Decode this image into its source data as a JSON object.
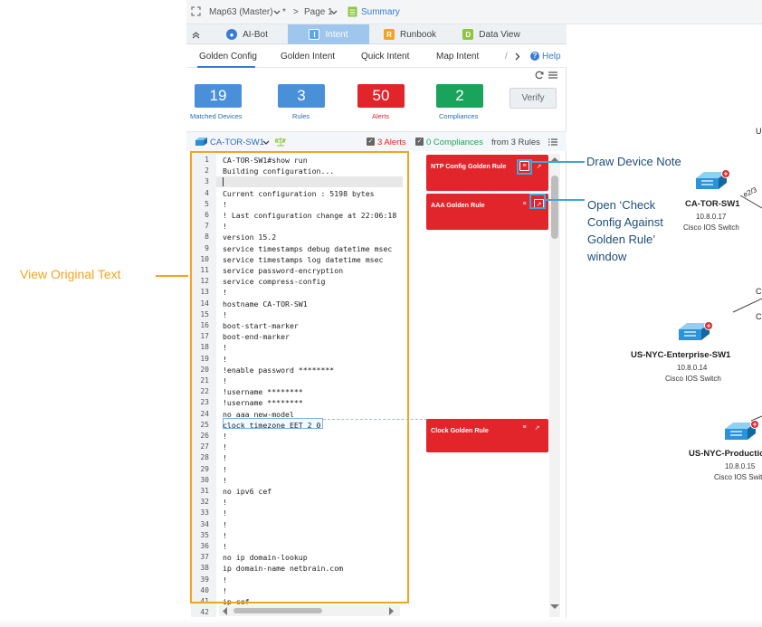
{
  "topbar": {
    "map_name": "Map63 (Master)",
    "modified_mark": "*",
    "separator": ">",
    "page": "Page 1",
    "summary": "Summary"
  },
  "tabs": [
    {
      "label": "AI-Bot",
      "icon": "ai"
    },
    {
      "label": "Intent",
      "icon": "I"
    },
    {
      "label": "Runbook",
      "icon": "R"
    },
    {
      "label": "Data View",
      "icon": "D"
    }
  ],
  "subtabs": [
    "Golden Config",
    "Golden Intent",
    "Quick Intent",
    "Map Intent"
  ],
  "subtabs_more": "/",
  "help_label": "Help",
  "stats": [
    {
      "value": "19",
      "label": "Matched Devices",
      "color": "#4a90d9"
    },
    {
      "value": "3",
      "label": "Rules",
      "color": "#4a90d9"
    },
    {
      "value": "50",
      "label": "Alerts",
      "color": "#e2242b"
    },
    {
      "value": "2",
      "label": "Compliances",
      "color": "#1aa35b"
    }
  ],
  "verify_label": "Verify",
  "device_bar": {
    "device": "CA-TOR-SW1",
    "alerts": "3 Alerts",
    "compliances": "0 Compliances",
    "from_rules": "from 3 Rules"
  },
  "code_lines": [
    {
      "n": "1",
      "text": "CA-TOR-SW1#show run"
    },
    {
      "n": "2",
      "text": "Building configuration..."
    },
    {
      "n": "3",
      "text": ""
    },
    {
      "n": "4",
      "text": "Current configuration : 5198 bytes"
    },
    {
      "n": "5",
      "text": "!"
    },
    {
      "n": "6",
      "text": "! Last configuration change at 22:06:18"
    },
    {
      "n": "7",
      "text": "!"
    },
    {
      "n": "8",
      "text": "version 15.2"
    },
    {
      "n": "9",
      "text": "service timestamps debug datetime msec"
    },
    {
      "n": "10",
      "text": "service timestamps log datetime msec"
    },
    {
      "n": "11",
      "text": "service password-encryption"
    },
    {
      "n": "12",
      "text": "service compress-config"
    },
    {
      "n": "13",
      "text": "!"
    },
    {
      "n": "14",
      "text": "hostname CA-TOR-SW1"
    },
    {
      "n": "15",
      "text": "!"
    },
    {
      "n": "16",
      "text": "boot-start-marker"
    },
    {
      "n": "17",
      "text": "boot-end-marker"
    },
    {
      "n": "18",
      "text": "!"
    },
    {
      "n": "19",
      "text": "!"
    },
    {
      "n": "20",
      "text": "!enable password ********"
    },
    {
      "n": "21",
      "text": "!"
    },
    {
      "n": "22",
      "text": "!username ********"
    },
    {
      "n": "23",
      "text": "!username ********"
    },
    {
      "n": "24",
      "text": "no aaa new-model"
    },
    {
      "n": "25",
      "text": "clock timezone EET 2 0"
    },
    {
      "n": "26",
      "text": "!"
    },
    {
      "n": "27",
      "text": "!"
    },
    {
      "n": "28",
      "text": "!"
    },
    {
      "n": "29",
      "text": "!"
    },
    {
      "n": "30",
      "text": "!"
    },
    {
      "n": "31",
      "text": "no ipv6 cef"
    },
    {
      "n": "32",
      "text": "!"
    },
    {
      "n": "33",
      "text": "!"
    },
    {
      "n": "34",
      "text": "!"
    },
    {
      "n": "35",
      "text": "!"
    },
    {
      "n": "36",
      "text": "!"
    },
    {
      "n": "37",
      "text": "no ip domain-lookup"
    },
    {
      "n": "38",
      "text": "ip domain-name netbrain.com"
    },
    {
      "n": "39",
      "text": "!"
    },
    {
      "n": "40",
      "text": "!"
    },
    {
      "n": "41",
      "text": "ip cef"
    },
    {
      "n": "42",
      "text": ""
    }
  ],
  "rules": [
    {
      "title": "NTP Config Golden Rule"
    },
    {
      "title": "AAA Golden Rule"
    },
    {
      "title": "Clock Golden Rule"
    }
  ],
  "annotations": {
    "view_original": "View Original Text",
    "draw_note": "Draw Device Note",
    "open_check": [
      "Open ‘Check",
      "Config Against",
      "Golden Rule’",
      "window"
    ]
  },
  "map": {
    "devices": [
      {
        "name": "CA-TOR-SW1",
        "ip": "10.8.0.17",
        "type": "Cisco IOS Switch"
      },
      {
        "name": "US-NYC-Enterprise-SW1",
        "ip": "10.8.0.14",
        "type": "Cisco IOS Switch"
      },
      {
        "name": "US-NYC-Productio",
        "ip": "10.8.0.15",
        "type": "Cisco IOS Swit"
      }
    ],
    "link_label": "e2/3",
    "edge_letters": [
      "U",
      "C",
      "C"
    ]
  },
  "colors": {
    "accent": "#3a7bd5",
    "alert_red": "#e2242b",
    "compliance_green": "#1aa35b",
    "annot_orange": "#f5a321",
    "annot_blue": "#3ea7dc"
  }
}
